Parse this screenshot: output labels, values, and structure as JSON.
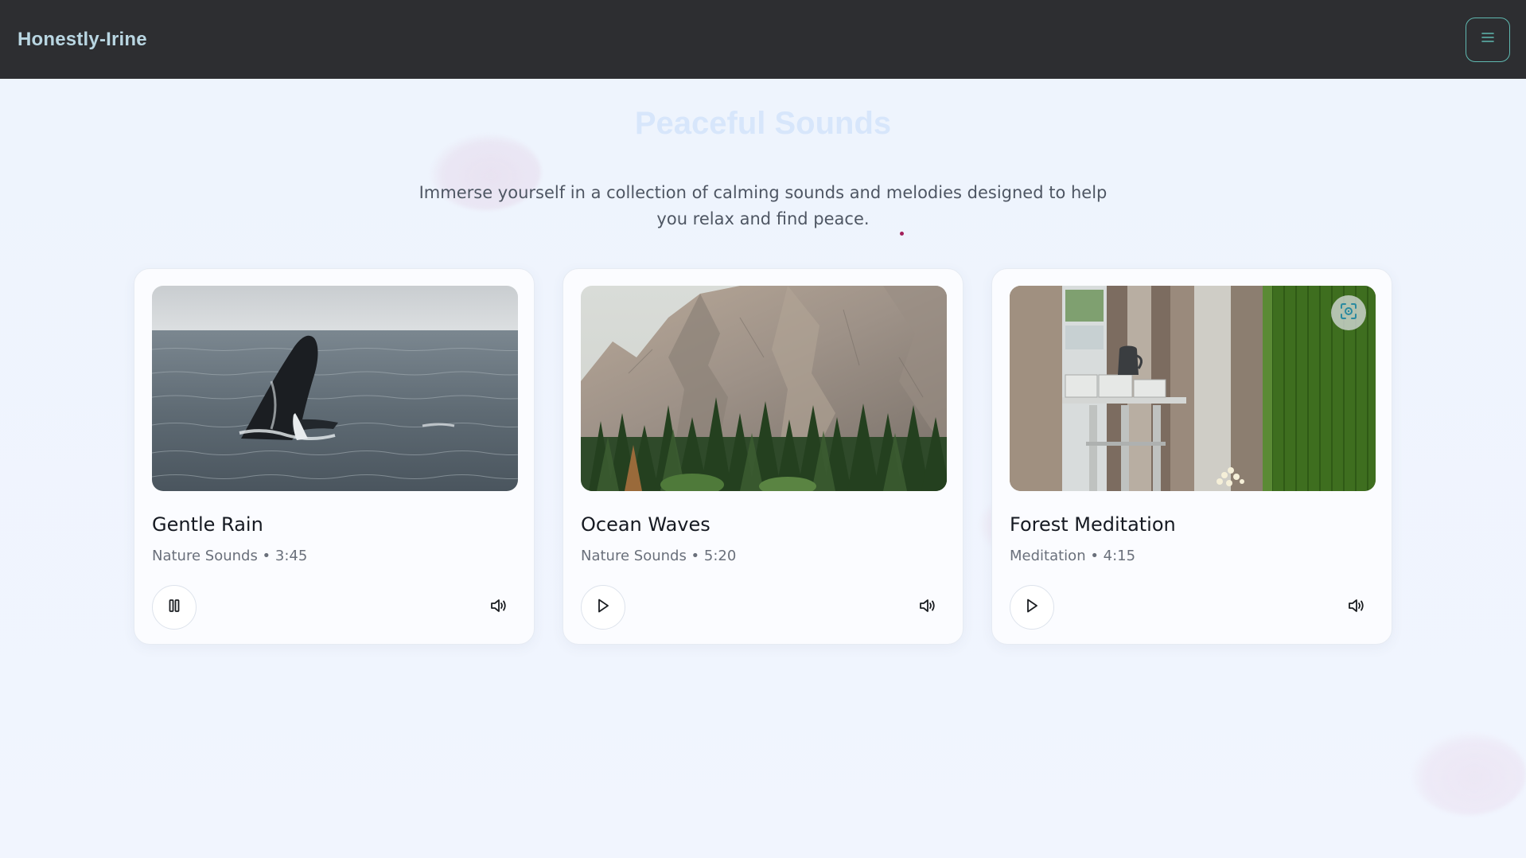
{
  "app": {
    "brand": "Honestly-Irine",
    "menu_icon": "hamburger-menu-icon"
  },
  "hero": {
    "title": "Peaceful Sounds",
    "subtitle": "Immerse yourself in a collection of calming sounds and melodies designed to help you relax and find peace."
  },
  "cards": [
    {
      "title": "Gentle Rain",
      "category": "Nature Sounds",
      "duration": "3:45",
      "meta": "Nature Sounds • 3:45",
      "image": "whale-breaching-ocean-photo",
      "state": "playing",
      "control_icon": "pause-icon",
      "volume_icon": "volume-icon"
    },
    {
      "title": "Ocean Waves",
      "category": "Nature Sounds",
      "duration": "5:20",
      "meta": "Nature Sounds • 5:20",
      "image": "mountain-forest-photo",
      "state": "paused",
      "control_icon": "play-icon",
      "volume_icon": "volume-icon"
    },
    {
      "title": "Forest Meditation",
      "category": "Meditation",
      "duration": "4:15",
      "meta": "Meditation • 4:15",
      "image": "kitchen-interior-photo",
      "state": "paused",
      "control_icon": "play-icon",
      "volume_icon": "volume-icon",
      "overlay_icon": "visual-search-icon"
    }
  ],
  "colors": {
    "navbar": "#2d2e31",
    "brand_text": "#b9d6e2",
    "accent": "#5fb8b0",
    "background": "#eef4fd",
    "title": "#d7e6fb"
  }
}
